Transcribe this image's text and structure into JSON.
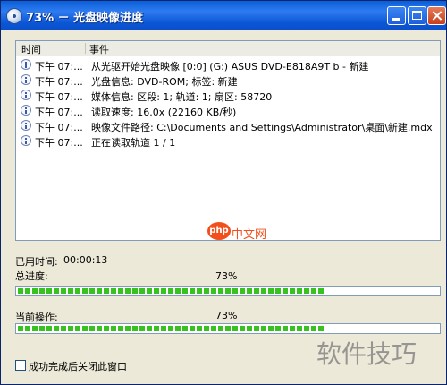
{
  "window": {
    "title": "73% － 光盘映像进度"
  },
  "log": {
    "columns": [
      "时间",
      "事件"
    ],
    "rows": [
      {
        "time": "下午 07:...",
        "message": "从光驱开始光盘映像 [0:0] (G:) ASUS DVD-E818A9T  b - 新建"
      },
      {
        "time": "下午 07:...",
        "message": "光盘信息: DVD-ROM; 标签: 新建"
      },
      {
        "time": "下午 07:...",
        "message": "媒体信息: 区段: 1; 轨道: 1; 扇区: 58720"
      },
      {
        "time": "下午 07:...",
        "message": "读取速度: 16.0x (22160 KB/秒)"
      },
      {
        "time": "下午 07:...",
        "message": "映像文件路径: C:\\Documents and Settings\\Administrator\\桌面\\新建.mdx"
      },
      {
        "time": "下午 07:...",
        "message": "正在读取轨道 1 / 1"
      }
    ]
  },
  "progress": {
    "elapsed_label": "已用时间:",
    "elapsed_value": "00:00:13",
    "total_label": "总进度:",
    "total_percent": "73%",
    "total_fraction": 0.73,
    "current_label": "当前操作:",
    "current_percent": "73%",
    "current_fraction": 0.73
  },
  "options": {
    "close_when_done_label": "成功完成后关闭此窗口",
    "close_when_done_checked": false
  },
  "watermarks": {
    "php_badge": "php",
    "php_site": "中文网",
    "corner": "软件技巧"
  },
  "colors": {
    "titlebar": "#0A5ED7",
    "progress_fill": "#37C21F",
    "window_bg": "#ECE9D8"
  }
}
